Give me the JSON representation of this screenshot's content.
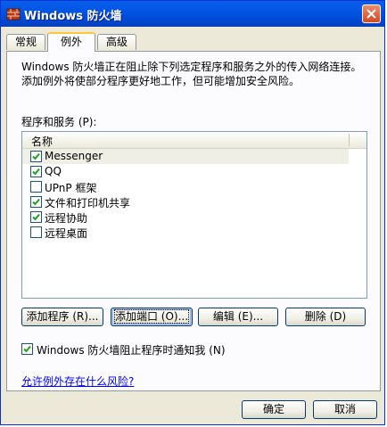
{
  "window": {
    "title": "Windows 防火墙"
  },
  "tabs": [
    {
      "label": "常规"
    },
    {
      "label": "例外"
    },
    {
      "label": "高级"
    }
  ],
  "exceptions": {
    "intro": "Windows 防火墙正在阻止除下列选定程序和服务之外的传入网络连接。添加例外将使部分程序更好地工作，但可能增加安全风险。",
    "list_label": "程序和服务 (P):",
    "column_header": "名称",
    "items": [
      {
        "label": "Messenger",
        "checked": true
      },
      {
        "label": "QQ",
        "checked": true
      },
      {
        "label": "UPnP 框架",
        "checked": false
      },
      {
        "label": "文件和打印机共享",
        "checked": true
      },
      {
        "label": "远程协助",
        "checked": true
      },
      {
        "label": "远程桌面",
        "checked": false
      }
    ],
    "buttons": {
      "add_program": "添加程序 (R)...",
      "add_port": "添加端口 (O)...",
      "edit": "编辑 (E)...",
      "delete": "删除 (D)"
    },
    "notify_label": "Windows 防火墙阻止程序时通知我 (N)",
    "notify_checked": true,
    "risk_link": "允许例外存在什么风险?"
  },
  "footer": {
    "ok": "确定",
    "cancel": "取消"
  },
  "colors": {
    "titlebar": "#0055e5",
    "face": "#ece9d8",
    "check": "#21a121",
    "link": "#0000ff"
  }
}
